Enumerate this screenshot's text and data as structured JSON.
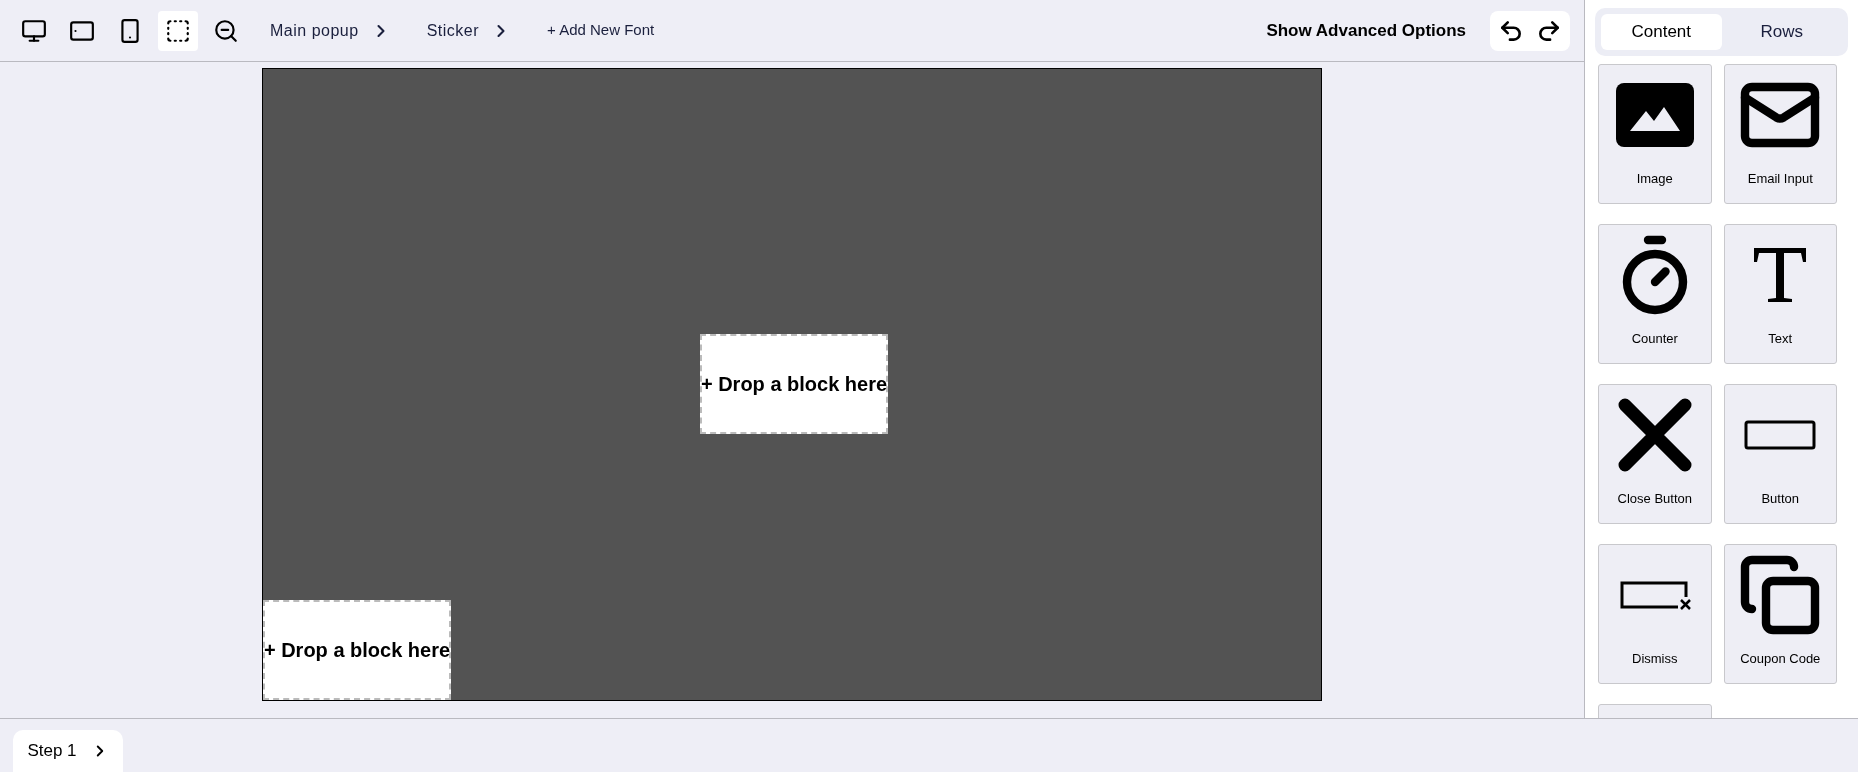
{
  "toolbar": {
    "view_buttons": [
      {
        "kind": "desktop",
        "selected": false
      },
      {
        "kind": "tablet",
        "selected": false
      },
      {
        "kind": "phone",
        "selected": false
      },
      {
        "kind": "select",
        "selected": true
      },
      {
        "kind": "zoom-out",
        "selected": false
      }
    ],
    "breadcrumbs": [
      "Main popup",
      "Sticker"
    ],
    "add_font": "+ Add New Font",
    "advanced_options": "Show Advanced Options"
  },
  "canvas": {
    "drop_zones": [
      {
        "label": "+ Drop a block here"
      },
      {
        "label": "+ Drop a block here"
      }
    ]
  },
  "sidebar": {
    "tabs": [
      {
        "label": "Content",
        "selected": true
      },
      {
        "label": "Rows",
        "selected": false
      }
    ],
    "blocks": [
      {
        "kind": "image",
        "label": "Image"
      },
      {
        "kind": "email",
        "label": "Email Input"
      },
      {
        "kind": "counter",
        "label": "Counter"
      },
      {
        "kind": "text",
        "label": "Text"
      },
      {
        "kind": "close",
        "label": "Close Button"
      },
      {
        "kind": "button",
        "label": "Button"
      },
      {
        "kind": "dismiss",
        "label": "Dismiss"
      },
      {
        "kind": "coupon",
        "label": "Coupon Code"
      },
      {
        "kind": "cut"
      }
    ]
  },
  "steps": [
    {
      "label": "Step 1"
    }
  ]
}
